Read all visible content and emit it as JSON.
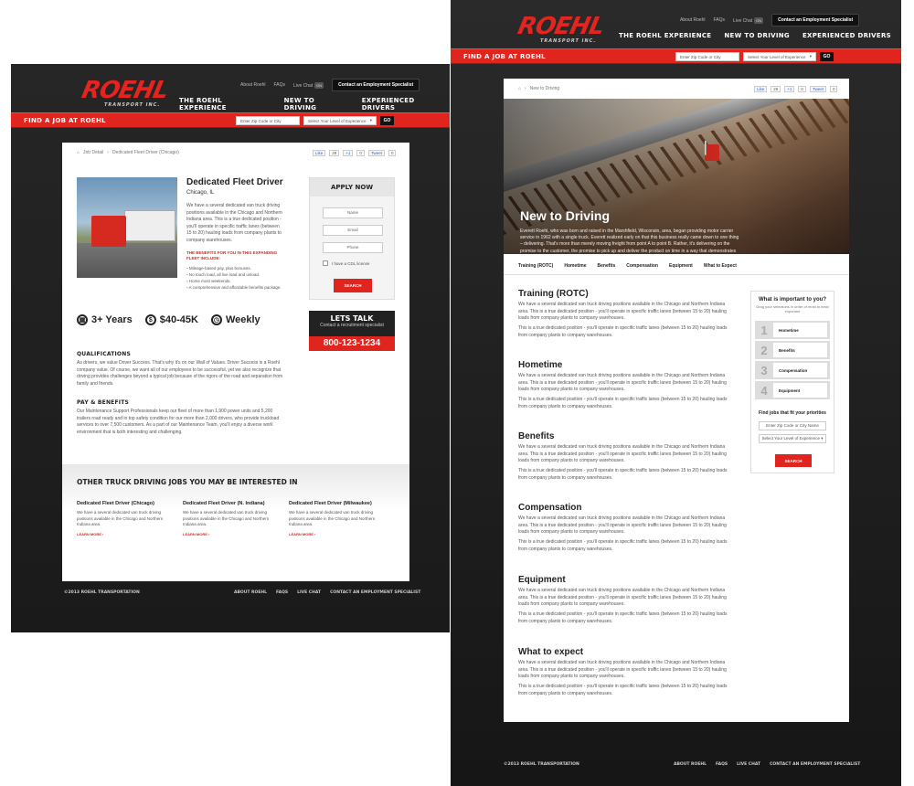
{
  "brand": {
    "logo_text": "ROEHL",
    "logo_sub": "TRANSPORT INC."
  },
  "colors": {
    "accent": "#e0251f",
    "dark": "#1e1e1e"
  },
  "header": {
    "top_links": [
      "About Roehl",
      "FAQs",
      "Live Chat"
    ],
    "chat_badge": "ON",
    "contact_button": "Contact an Employment Specialist",
    "nav": [
      "THE ROEHL EXPERIENCE",
      "NEW TO DRIVING",
      "EXPERIENCED DRIVERS"
    ]
  },
  "jobbar": {
    "label": "FIND A JOB AT ROEHL",
    "zip_placeholder": "Enter Zip Code or City",
    "experience_placeholder": "Select Your Level of Experience",
    "go": "GO"
  },
  "job_page": {
    "breadcrumb": [
      "Job Detail",
      "Dedicated Fleet Driver (Chicago)"
    ],
    "social": {
      "like": "Like",
      "like_count": "29",
      "plus": "+1",
      "plus_count": "0",
      "tweet": "Tweet",
      "tweet_count": "0"
    },
    "title": "Dedicated Fleet Driver",
    "location": "Chicago, IL",
    "intro": "We have a several dedicated van truck driving positions available in the Chicago and Northern Indiana area. This is a true dedicated position - you'll operate in specific traffic lanes (between 15 to 20) hauling loads from company plants to company warehouses.",
    "benefits_head": "THE BENEFITS FOR YOU IN THIS EXPANDING FLEET INCLUDE:",
    "benefits": [
      "Mileage-based pay, plus bonuses.",
      "No touch load, all live load and unload.",
      "Home most weekends.",
      "A comprehensive and affordable benefits package."
    ],
    "apply": {
      "title": "APPLY NOW",
      "name": "Name",
      "email": "Email",
      "phone": "Phone",
      "cdl": "I have a CDL license",
      "search": "SEARCH"
    },
    "stats": [
      {
        "icon": "calendar-icon",
        "text": "3+ Years"
      },
      {
        "icon": "dollar-icon",
        "text": "$40-45K"
      },
      {
        "icon": "clock-icon",
        "text": "Weekly"
      }
    ],
    "talk": {
      "title": "LETS TALK",
      "sub": "Contact a recruitment specialist",
      "phone": "800-123-1234"
    },
    "qualifications_head": "QUALIFICATIONS",
    "qualifications": "As drivers, we value Driver Success. That's why it's on our Wall of Values. Driver Success is a Roehl company value. Of course, we want all of our employees to be successful, yet we also recognize that driving provides challenges beyond a typical job because of the rigors of the road and separation from family and friends.",
    "pay_head": "PAY & BENEFITS",
    "pay": "Our Maintenance Support Professionals keep our fleet of more than 1,900 power units and 5,200 trailers road ready and in top safety condition for our more than 2,000 drivers, who provide truckload services to over 7,500 customers. As a part of our Maintenance Team, you'll enjoy a diverse work environment that is both interesting and challenging.",
    "other_head": "OTHER TRUCK DRIVING JOBS YOU MAY BE INTERESTED IN",
    "other_jobs": [
      {
        "title": "Dedicated Fleet Driver (Chicago)",
        "desc": "We have a several dedicated van truck driving positions available in the Chicago and Northern Indiana area.",
        "more": "LEARN MORE ›"
      },
      {
        "title": "Dedicated Fleet Driver (N. Indiana)",
        "desc": "We have a several dedicated van truck driving positions available in the Chicago and Northern Indiana area.",
        "more": "LEARN MORE ›"
      },
      {
        "title": "Dedicated Fleet Driver (Milwaukee)",
        "desc": "We have a several dedicated van truck driving positions available in the Chicago and Northern Indiana area.",
        "more": "LEARN MORE ›"
      }
    ]
  },
  "footer": {
    "copyright": "©2013 ROEHL TRANSPORTATION",
    "links": [
      "ABOUT ROEHL",
      "FAQS",
      "LIVE CHAT",
      "CONTACT AN EMPLOYMENT SPECIALIST"
    ]
  },
  "newdriving_page": {
    "breadcrumb": "New to Driving",
    "social": {
      "like": "Like",
      "like_count": "29",
      "plus": "+1",
      "plus_count": "0",
      "tweet": "Tweet",
      "tweet_count": "0"
    },
    "hero_title": "New to Driving",
    "hero_text": "Everett Roehl, who was born and raised in the Marshfield, Wisconsin, area, began providing motor carrier service in 1962 with a single truck. Everett realized early on that this business really came down to one thing – delivering. That's more than merely moving freight from point A to point B. Rather, it's delivering on the promise to the customer, the promise to pick up and deliver the product on time in a way that demonstrates and promotes safety.",
    "tabs": [
      "Training (ROTC)",
      "Hometime",
      "Benefits",
      "Compensation",
      "Equipment",
      "What to Expect"
    ],
    "sections": [
      {
        "title": "Training (ROTC)",
        "p1": "We have a several dedicated van truck driving positions available in the Chicago and Northern Indiana area. This is a true dedicated position - you'll operate in specific traffic lanes (between 15 to 20) hauling loads from company plants to company warehouses.",
        "p2": "This is a true dedicated position - you'll operate in specific traffic lanes (between 15 to 20) hauling loads from company plants to company warehouses."
      },
      {
        "title": "Hometime",
        "p1": "We have a several dedicated van truck driving positions available in the Chicago and Northern Indiana area. This is a true dedicated position - you'll operate in specific traffic lanes (between 15 to 20) hauling loads from company plants to company warehouses.",
        "p2": "This is a true dedicated position - you'll operate in specific traffic lanes (between 15 to 20) hauling loads from company plants to company warehouses."
      },
      {
        "title": "Benefits",
        "p1": "We have a several dedicated van truck driving positions available in the Chicago and Northern Indiana area. This is a true dedicated position - you'll operate in specific traffic lanes (between 15 to 20) hauling loads from company plants to company warehouses.",
        "p2": "This is a true dedicated position - you'll operate in specific traffic lanes (between 15 to 20) hauling loads from company plants to company warehouses."
      },
      {
        "title": "Compensation",
        "p1": "We have a several dedicated van truck driving positions available in the Chicago and Northern Indiana area. This is a true dedicated position - you'll operate in specific traffic lanes (between 15 to 20) hauling loads from company plants to company warehouses.",
        "p2": "This is a true dedicated position - you'll operate in specific traffic lanes (between 15 to 20) hauling loads from company plants to company warehouses."
      },
      {
        "title": "Equipment",
        "p1": "We have a several dedicated van truck driving positions available in the Chicago and Northern Indiana area. This is a true dedicated position - you'll operate in specific traffic lanes (between 15 to 20) hauling loads from company plants to company warehouses.",
        "p2": "This is a true dedicated position - you'll operate in specific traffic lanes (between 15 to 20) hauling loads from company plants to company warehouses."
      },
      {
        "title": "What to expect",
        "p1": "We have a several dedicated van truck driving positions available in the Chicago and Northern Indiana area. This is a true dedicated position - you'll operate in specific traffic lanes (between 15 to 20) hauling loads from company plants to company warehouses.",
        "p2": "This is a true dedicated position - you'll operate in specific traffic lanes (between 15 to 20) hauling loads from company plants to company warehouses."
      }
    ],
    "priorities": {
      "title": "What is important to you?",
      "sub": "Drag your selections in order of most to least important",
      "items": [
        "Hometime",
        "Benefits",
        "Compensation",
        "Equipment"
      ],
      "find_head": "Find jobs that fit your priorities",
      "zip_placeholder": "Enter Zip Code or City Name",
      "experience_placeholder": "Select Your Level of Experience",
      "search": "SEARCH"
    }
  }
}
